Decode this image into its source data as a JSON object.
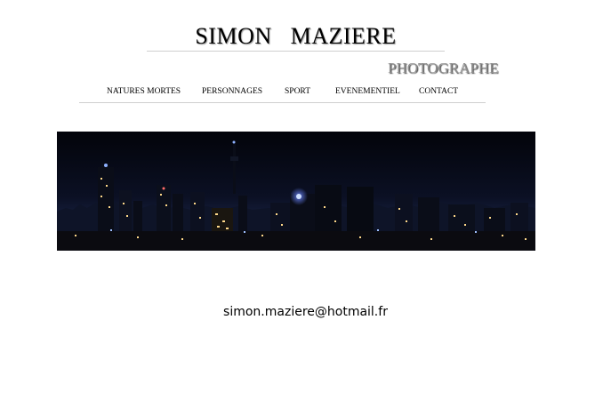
{
  "header": {
    "site_name": "SIMON   MAZIERE",
    "subtitle": "PHOTOGRAPHE"
  },
  "nav": {
    "items": [
      {
        "label": "NATURES MORTES"
      },
      {
        "label": "PERSONNAGES"
      },
      {
        "label": "SPORT"
      },
      {
        "label": "EVENEMENTIEL"
      },
      {
        "label": "CONTACT"
      }
    ]
  },
  "banner": {
    "image": "night-city-skyline-panorama",
    "colors": {
      "sky_top": "#03040a",
      "sky_horizon": "#1a2446",
      "buildings": "#0a0d18",
      "lights": "#ffd98a"
    }
  },
  "footer": {
    "email": "simon.maziere@hotmail.fr"
  }
}
